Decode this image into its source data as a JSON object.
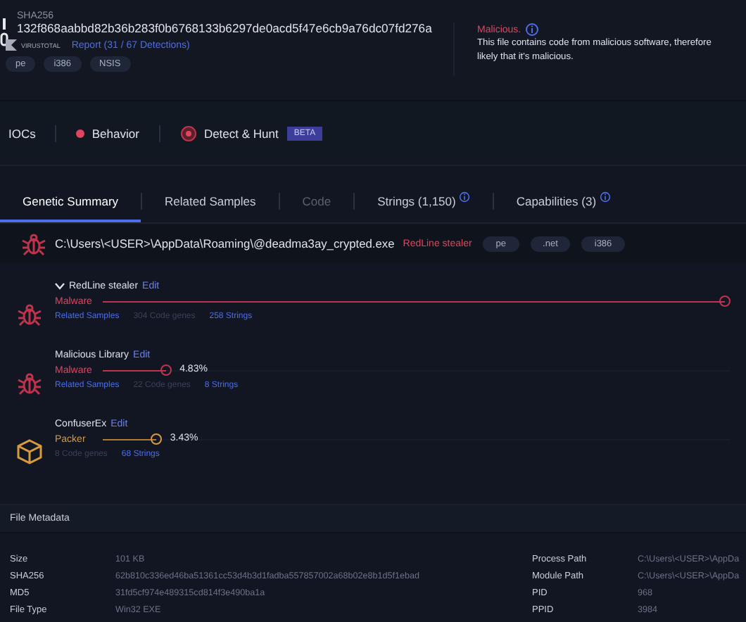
{
  "header": {
    "hash_label": "SHA256",
    "hash": "132f868aabbd82b36b283f0b6768133b6297de0acd5f47e6cb9a76dc07fd276a",
    "virustotal_label": "VIRUSTOTAL",
    "report_link": "Report (31 / 67 Detections)",
    "tags": [
      "pe",
      "i386",
      "NSIS"
    ],
    "verdict_title": "Malicious.",
    "verdict_lines": [
      "This file contains code from malicious software, therefore",
      "likely that it's malicious."
    ]
  },
  "nav": [
    {
      "label": "IOCs",
      "kind": "plain"
    },
    {
      "label": "Behavior",
      "kind": "dot"
    },
    {
      "label": "Detect & Hunt",
      "kind": "target",
      "badge": "BETA"
    }
  ],
  "tabs": [
    {
      "label": "Genetic Summary",
      "selected": true,
      "disabled": false,
      "info": false
    },
    {
      "label": "Related Samples",
      "selected": false,
      "disabled": false,
      "info": false
    },
    {
      "label": "Code",
      "selected": false,
      "disabled": true,
      "info": false
    },
    {
      "label": "Strings (1,150)",
      "selected": false,
      "disabled": false,
      "info": true
    },
    {
      "label": "Capabilities (3)",
      "selected": false,
      "disabled": false,
      "info": true
    }
  ],
  "file": {
    "path": "C:\\Users\\<USER>\\AppData\\Roaming\\@deadma3ay_crypted.exe",
    "family": "RedLine stealer",
    "tags": [
      "pe",
      ".net",
      "i386"
    ]
  },
  "families": [
    {
      "name": "RedLine stealer",
      "kind": "malware",
      "expanded": true,
      "edit": "Edit",
      "category": "Malware",
      "level": 0.99,
      "links": [
        {
          "text": "Related Samples",
          "kind": "link"
        },
        {
          "text": "304 Code genes",
          "kind": "muted"
        },
        {
          "text": "258 Strings",
          "kind": "link"
        }
      ]
    },
    {
      "name": "Malicious Library",
      "kind": "malware",
      "expanded": false,
      "edit": "Edit",
      "category": "Malware",
      "level": 0.1,
      "percent": "4.83%",
      "links": [
        {
          "text": "Related Samples",
          "kind": "link"
        },
        {
          "text": "22 Code genes",
          "kind": "muted"
        },
        {
          "text": "8 Strings",
          "kind": "link"
        }
      ]
    },
    {
      "name": "ConfuserEx",
      "kind": "packer",
      "expanded": false,
      "edit": "Edit",
      "category": "Packer",
      "level": 0.085,
      "percent": "3.43%",
      "links": [
        {
          "text": "8 Code genes",
          "kind": "muted"
        },
        {
          "text": "68 Strings",
          "kind": "link"
        }
      ]
    }
  ],
  "metadata": {
    "title": "File Metadata",
    "left": [
      {
        "key": "Size",
        "value": "101 KB"
      },
      {
        "key": "SHA256",
        "value": "62b810c336ed46ba51361cc53d4b3d1fadba557857002a68b02e8b1d5f1ebad"
      },
      {
        "key": "MD5",
        "value": "31fd5cf974e489315cd814f3e490ba1a"
      },
      {
        "key": "File Type",
        "value": "Win32 EXE"
      }
    ],
    "right": [
      {
        "key": "Process Path",
        "value": "C:\\Users\\<USER>\\AppDa"
      },
      {
        "key": "Module Path",
        "value": "C:\\Users\\<USER>\\AppDa"
      },
      {
        "key": "PID",
        "value": "968"
      },
      {
        "key": "PPID",
        "value": "3984"
      }
    ]
  }
}
